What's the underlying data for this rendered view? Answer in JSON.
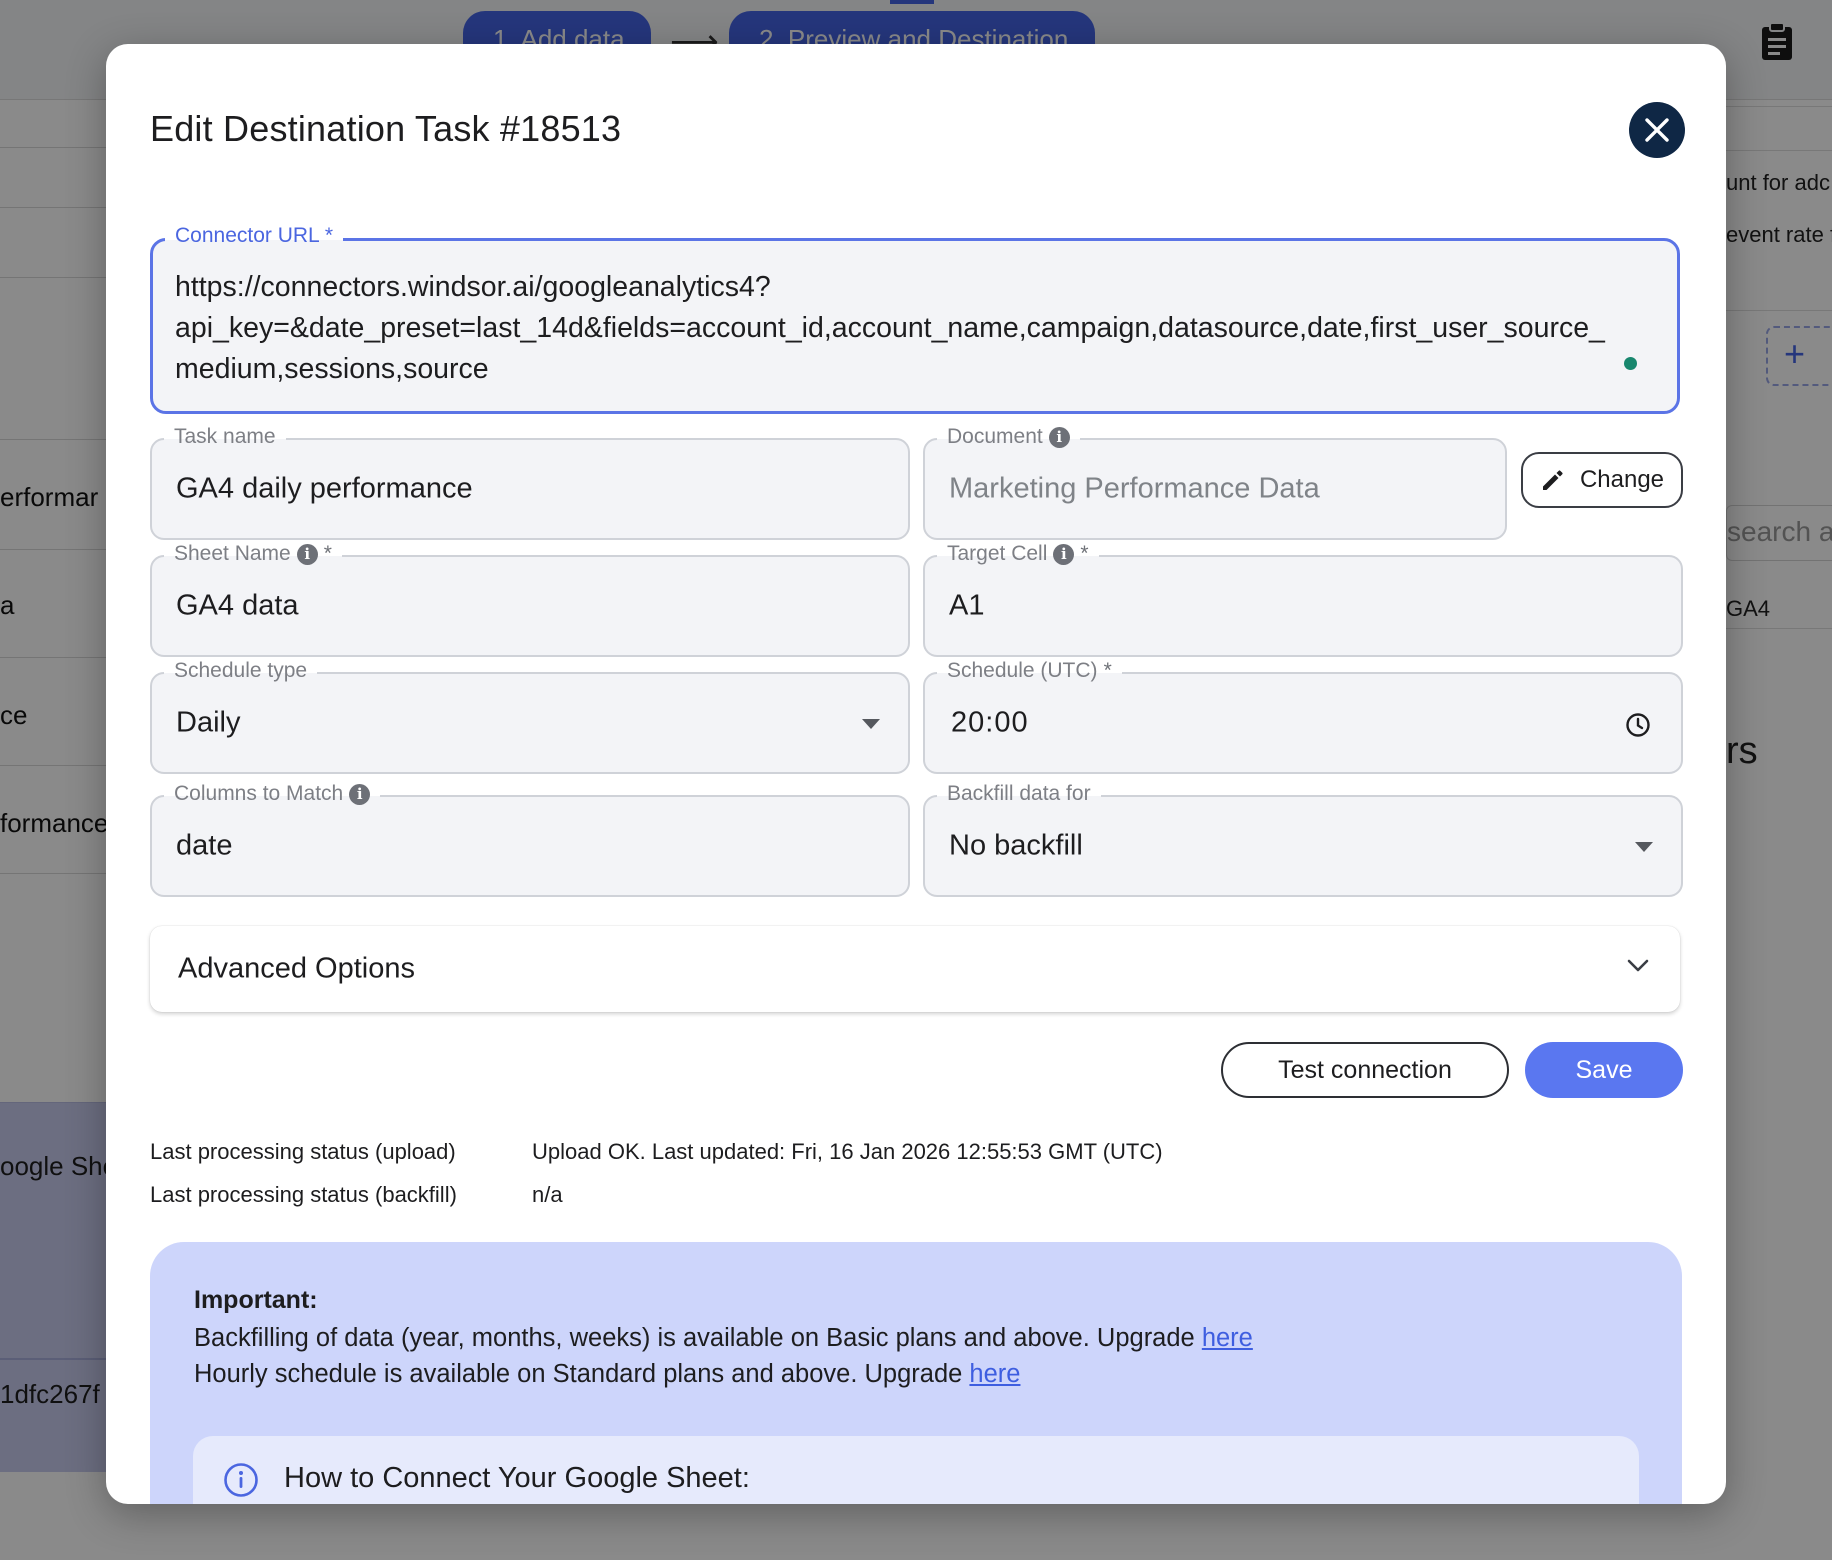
{
  "background": {
    "steps": [
      "1. Add data",
      "2. Preview and Destination"
    ],
    "left_rows": [
      "erformar",
      "a",
      "ce",
      "formance"
    ],
    "left_google": "oogle She",
    "left_id": "1dfc267f",
    "right_texts": [
      "unt for adc",
      "event rate f"
    ],
    "right_search": "search a",
    "right_ga4": "GA4",
    "right_big": "rs"
  },
  "modal": {
    "title": "Edit Destination Task #18513",
    "connector_url": {
      "label": "Connector URL",
      "required": "*",
      "line1": "https://connectors.windsor.ai/googleanalytics4?",
      "line2": "api_key=&date_preset=last_14d&fields=account_id,account_name,campaign,datasource,date,first_user_source_",
      "line3": "medium,sessions,source"
    },
    "task_name": {
      "label": "Task name",
      "value": "GA4 daily performance"
    },
    "document": {
      "label": "Document",
      "value": "Marketing Performance Data",
      "change_label": "Change"
    },
    "sheet_name": {
      "label": "Sheet Name",
      "required": "*",
      "value": "GA4 data"
    },
    "target_cell": {
      "label": "Target Cell",
      "required": "*",
      "value": "A1"
    },
    "schedule_type": {
      "label": "Schedule type",
      "value": "Daily"
    },
    "schedule_utc": {
      "label": "Schedule (UTC)",
      "required": "*",
      "value": "20:00"
    },
    "columns_to_match": {
      "label": "Columns to Match",
      "value": "date"
    },
    "backfill": {
      "label": "Backfill data for",
      "value": "No backfill"
    },
    "advanced_options": "Advanced Options",
    "test_connection": "Test connection",
    "save": "Save",
    "status": [
      {
        "key": "Last processing status (upload)",
        "value": "Upload OK. Last updated: Fri, 16 Jan 2026 12:55:53 GMT (UTC)"
      },
      {
        "key": "Last processing status (backfill)",
        "value": "n/a"
      }
    ],
    "important": {
      "title": "Important:",
      "line1_text": "Backfilling of data (year, months, weeks) is available on Basic plans and above. Upgrade ",
      "line1_link": "here",
      "line2_text": "Hourly schedule is available on Standard plans and above. Upgrade ",
      "line2_link": "here",
      "howto_title": "How to Connect Your Google Sheet:"
    }
  },
  "colors": {
    "accent": "#5a77f0",
    "focus_border": "#5b74e6",
    "close_button": "#0f2745",
    "notice_bg": "#cdd5fb"
  }
}
